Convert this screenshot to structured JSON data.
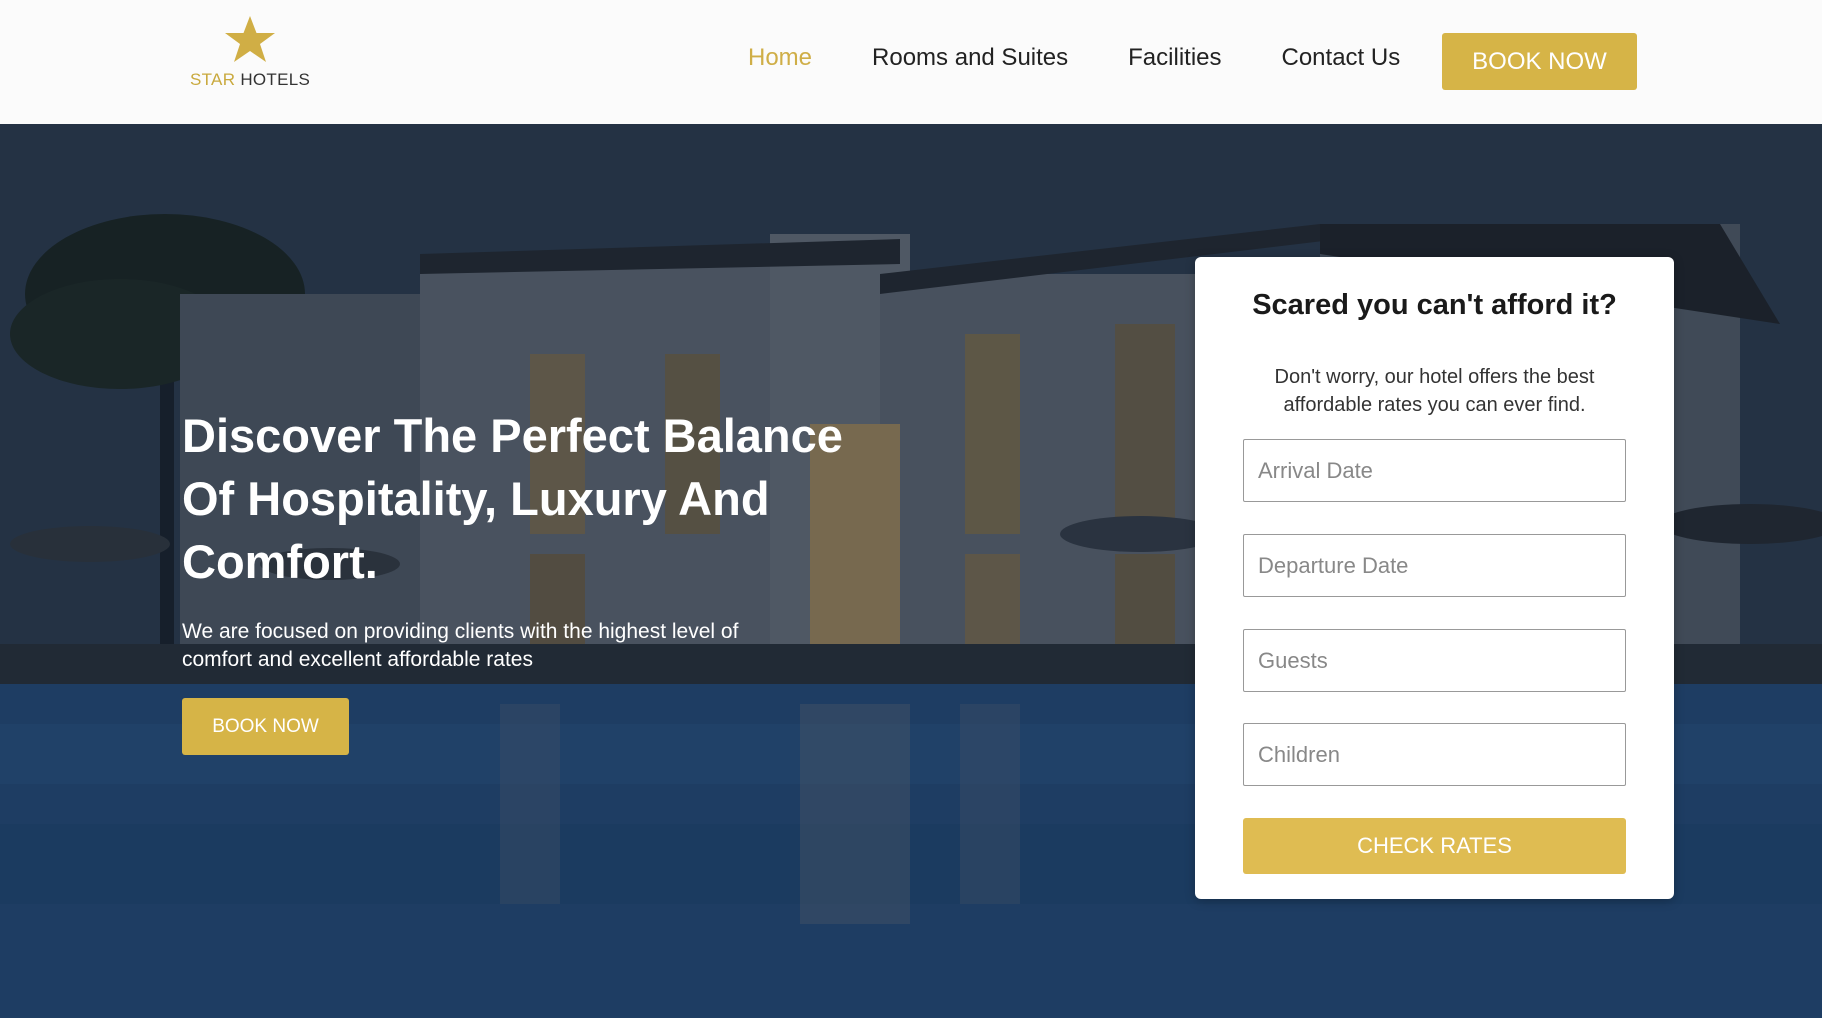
{
  "brand": {
    "name_part1": "STAR",
    "name_part2": "HOTELS",
    "logo_icon": "star-icon",
    "accent_color": "#d6b447"
  },
  "nav": {
    "items": [
      {
        "label": "Home",
        "active": true
      },
      {
        "label": "Rooms and Suites",
        "active": false
      },
      {
        "label": "Facilities",
        "active": false
      },
      {
        "label": "Contact Us",
        "active": false
      }
    ],
    "book_label": "BOOK NOW"
  },
  "hero": {
    "title": "Discover The Perfect Balance Of Hospitality, Luxury And Comfort.",
    "subtitle": "We are focused on providing clients with the highest level of comfort and excellent affordable rates",
    "book_label": "BOOK NOW"
  },
  "booking_form": {
    "title": "Scared you can't afford it?",
    "description": "Don't worry, our hotel offers the best affordable rates you can ever find.",
    "fields": {
      "arrival": {
        "placeholder": "Arrival Date",
        "value": ""
      },
      "departure": {
        "placeholder": "Departure Date",
        "value": ""
      },
      "guests": {
        "placeholder": "Guests",
        "value": ""
      },
      "children": {
        "placeholder": "Children",
        "value": ""
      }
    },
    "submit_label": "CHECK RATES"
  }
}
